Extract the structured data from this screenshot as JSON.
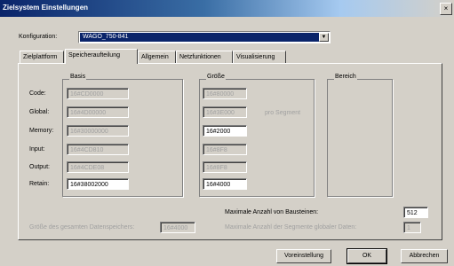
{
  "window": {
    "title": "Zielsystem Einstellungen",
    "close_glyph": "×"
  },
  "config": {
    "label": "Konfiguration:",
    "value": "WAGO_750-841"
  },
  "tabs": [
    "Zielplattform",
    "Speicheraufteilung",
    "Allgemein",
    "Netzfunktionen",
    "Visualisierung"
  ],
  "groups": {
    "basis": "Basis",
    "groesse": "Größe",
    "bereich": "Bereich"
  },
  "rows": [
    {
      "label": "Code:",
      "basis": "16#CD0000",
      "groesse": "16#80000"
    },
    {
      "label": "Global:",
      "basis": "16#4D00000",
      "groesse": "16#3E000"
    },
    {
      "label": "Memory:",
      "basis": "16#30000000",
      "groesse": "16#2000"
    },
    {
      "label": "Input:",
      "basis": "16#4CD810",
      "groesse": "16#8F8"
    },
    {
      "label": "Output:",
      "basis": "16#4CDE08",
      "groesse": "16#8F8"
    },
    {
      "label": "Retain:",
      "basis": "16#38002000",
      "groesse": "16#4000"
    }
  ],
  "global_note": "pro Segment",
  "bottom": {
    "max_bausteine_label": "Maximale Anzahl von Bausteinen:",
    "max_bausteine_value": "512",
    "groesse_label": "Größe des gesamten Datenspeichers:",
    "groesse_value": "16#4000",
    "max_segmente_label": "Maximale Anzahl der Segmente globaler Daten:",
    "max_segmente_value": "1"
  },
  "buttons": {
    "voreinstellung": "Voreinstellung",
    "ok": "OK",
    "abbrechen": "Abbrechen"
  }
}
